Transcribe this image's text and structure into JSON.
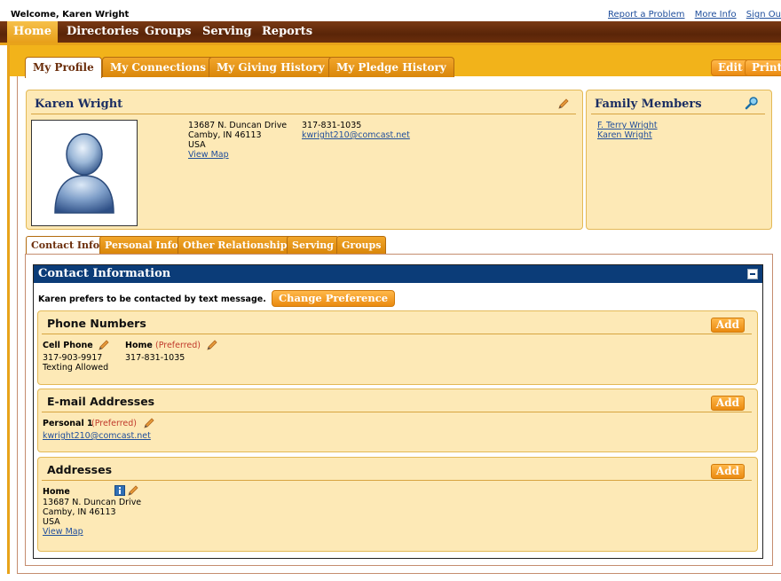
{
  "topbar": {
    "welcome": "Welcome, Karen Wright",
    "links": [
      "Report a Problem",
      "More Info",
      "Sign Ou"
    ]
  },
  "nav": {
    "items": [
      "Home",
      "Directories",
      "Groups",
      "Serving",
      "Reports"
    ]
  },
  "profile_tabs": [
    "My Profile",
    "My Connections",
    "My Giving History",
    "My Pledge History"
  ],
  "actions": {
    "edit": "Edit",
    "print": "Print"
  },
  "profile": {
    "name": "Karen Wright",
    "address_line1": "13687 N. Duncan Drive",
    "address_line2": "Camby, IN 46113",
    "country": "USA",
    "view_map": "View Map",
    "phone": "317-831-1035",
    "email": "kwright210@comcast.net"
  },
  "family": {
    "title": "Family Members",
    "members": [
      "F. Terry Wright",
      "Karen Wright"
    ]
  },
  "sub_tabs": [
    "Contact Info",
    "Personal Info",
    "Other Relationships",
    "Serving",
    "Groups"
  ],
  "contact": {
    "header": "Contact Information",
    "preference_text": "Karen prefers to be contacted by text message.",
    "change_preference": "Change Preference",
    "add_label": "Add",
    "phones": {
      "title": "Phone Numbers",
      "cell_label": "Cell Phone",
      "cell_number": "317-903-9917",
      "cell_note": "Texting Allowed",
      "home_label": "Home",
      "home_pref": "(Preferred)",
      "home_number": "317-831-1035"
    },
    "emails": {
      "title": "E-mail Addresses",
      "label": "Personal 1",
      "pref": "(Preferred)",
      "value": "kwright210@comcast.net"
    },
    "addresses": {
      "title": "Addresses",
      "label": "Home",
      "line1": "13687 N. Duncan Drive",
      "line2": "Camby, IN 46113",
      "country": "USA",
      "view_map": "View Map"
    }
  },
  "colors": {
    "nav_brown": "#5a2508",
    "accent_orange": "#f2b31a",
    "panel_bg": "#fde9b6",
    "header_blue": "#0b3c78"
  }
}
